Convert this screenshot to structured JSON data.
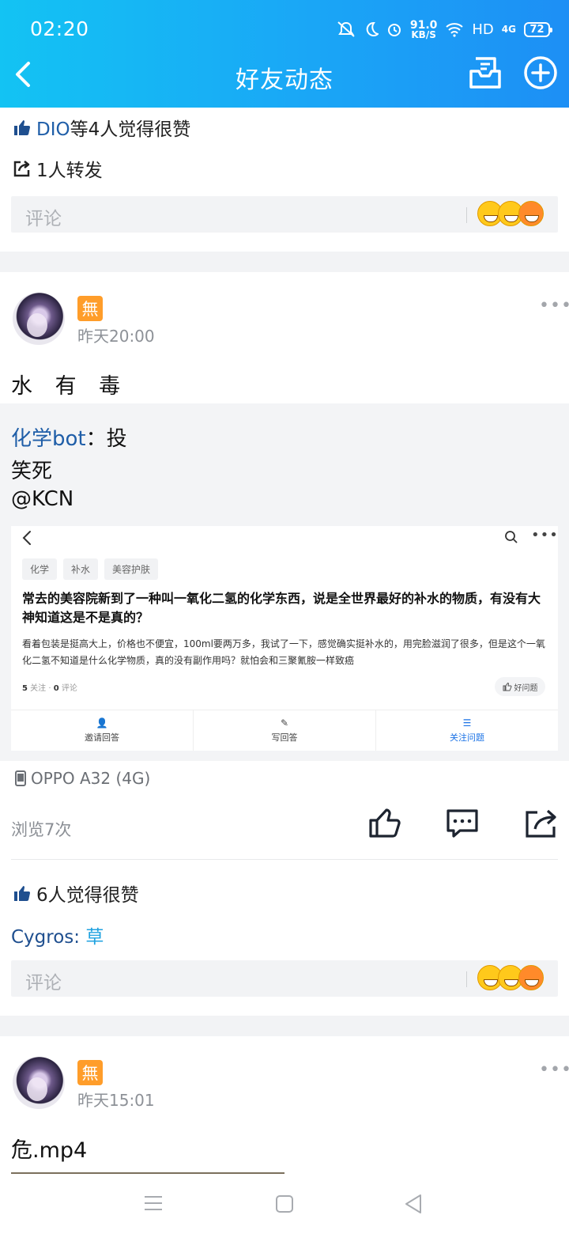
{
  "status_bar": {
    "time": "02:20",
    "speed": "91.0",
    "speed_unit": "KB/S",
    "hd": "HD",
    "net": "4G",
    "battery": "72"
  },
  "header": {
    "title": "好友动态"
  },
  "prev_post": {
    "likes_user": "DIO",
    "likes_suffix": "等4人觉得很赞",
    "share_text": "1人转发",
    "comment_placeholder": "评论"
  },
  "post1": {
    "badge": "無",
    "time": "昨天20:00",
    "text": "水 有 毒",
    "quote_author": "化学bot",
    "quote_sep": "：",
    "quote_text1": "投",
    "quote_text2": "笑死",
    "quote_mention": "@KCN",
    "card": {
      "tags": [
        "化学",
        "补水",
        "美容护肤"
      ],
      "title": "常去的美容院新到了一种叫一氧化二氢的化学东西，说是全世界最好的补水的物质，有没有大神知道这是不是真的？",
      "body": "看着包装是挺高大上，价格也不便宜，100ml要两万多，我试了一下，感觉确实挺补水的，用完脸滋润了很多，但是这个一氧化二氢不知道是什么化学物质，真的没有副作用吗？就怕会和三聚氰胺一样致癌",
      "followers_count": "5",
      "followers_label": "关注",
      "comments_count": "0",
      "comments_label": "评论",
      "good_question": "好问题",
      "actions": [
        "邀请回答",
        "写回答",
        "关注问题"
      ]
    },
    "device": "OPPO A32 (4G)",
    "views": "浏览7次",
    "likes": "6人觉得很赞",
    "comment_user": "Cygros:",
    "comment_text": "草",
    "comment_placeholder": "评论"
  },
  "post2": {
    "badge": "無",
    "time": "昨天15:01",
    "text": "危.mp4"
  },
  "icons": {
    "back": "chevron-left-icon",
    "inbox": "mail-tray-icon",
    "add": "plus-circle-icon",
    "like": "thumbs-up-icon",
    "comment": "chat-bubble-icon",
    "share": "share-icon",
    "device": "phone-icon"
  },
  "colors": {
    "header_start": "#13c3f3",
    "header_end": "#1d8ff5",
    "link": "#1f5ea8",
    "badge": "#ff9d2a",
    "accent": "#1a72e6"
  }
}
